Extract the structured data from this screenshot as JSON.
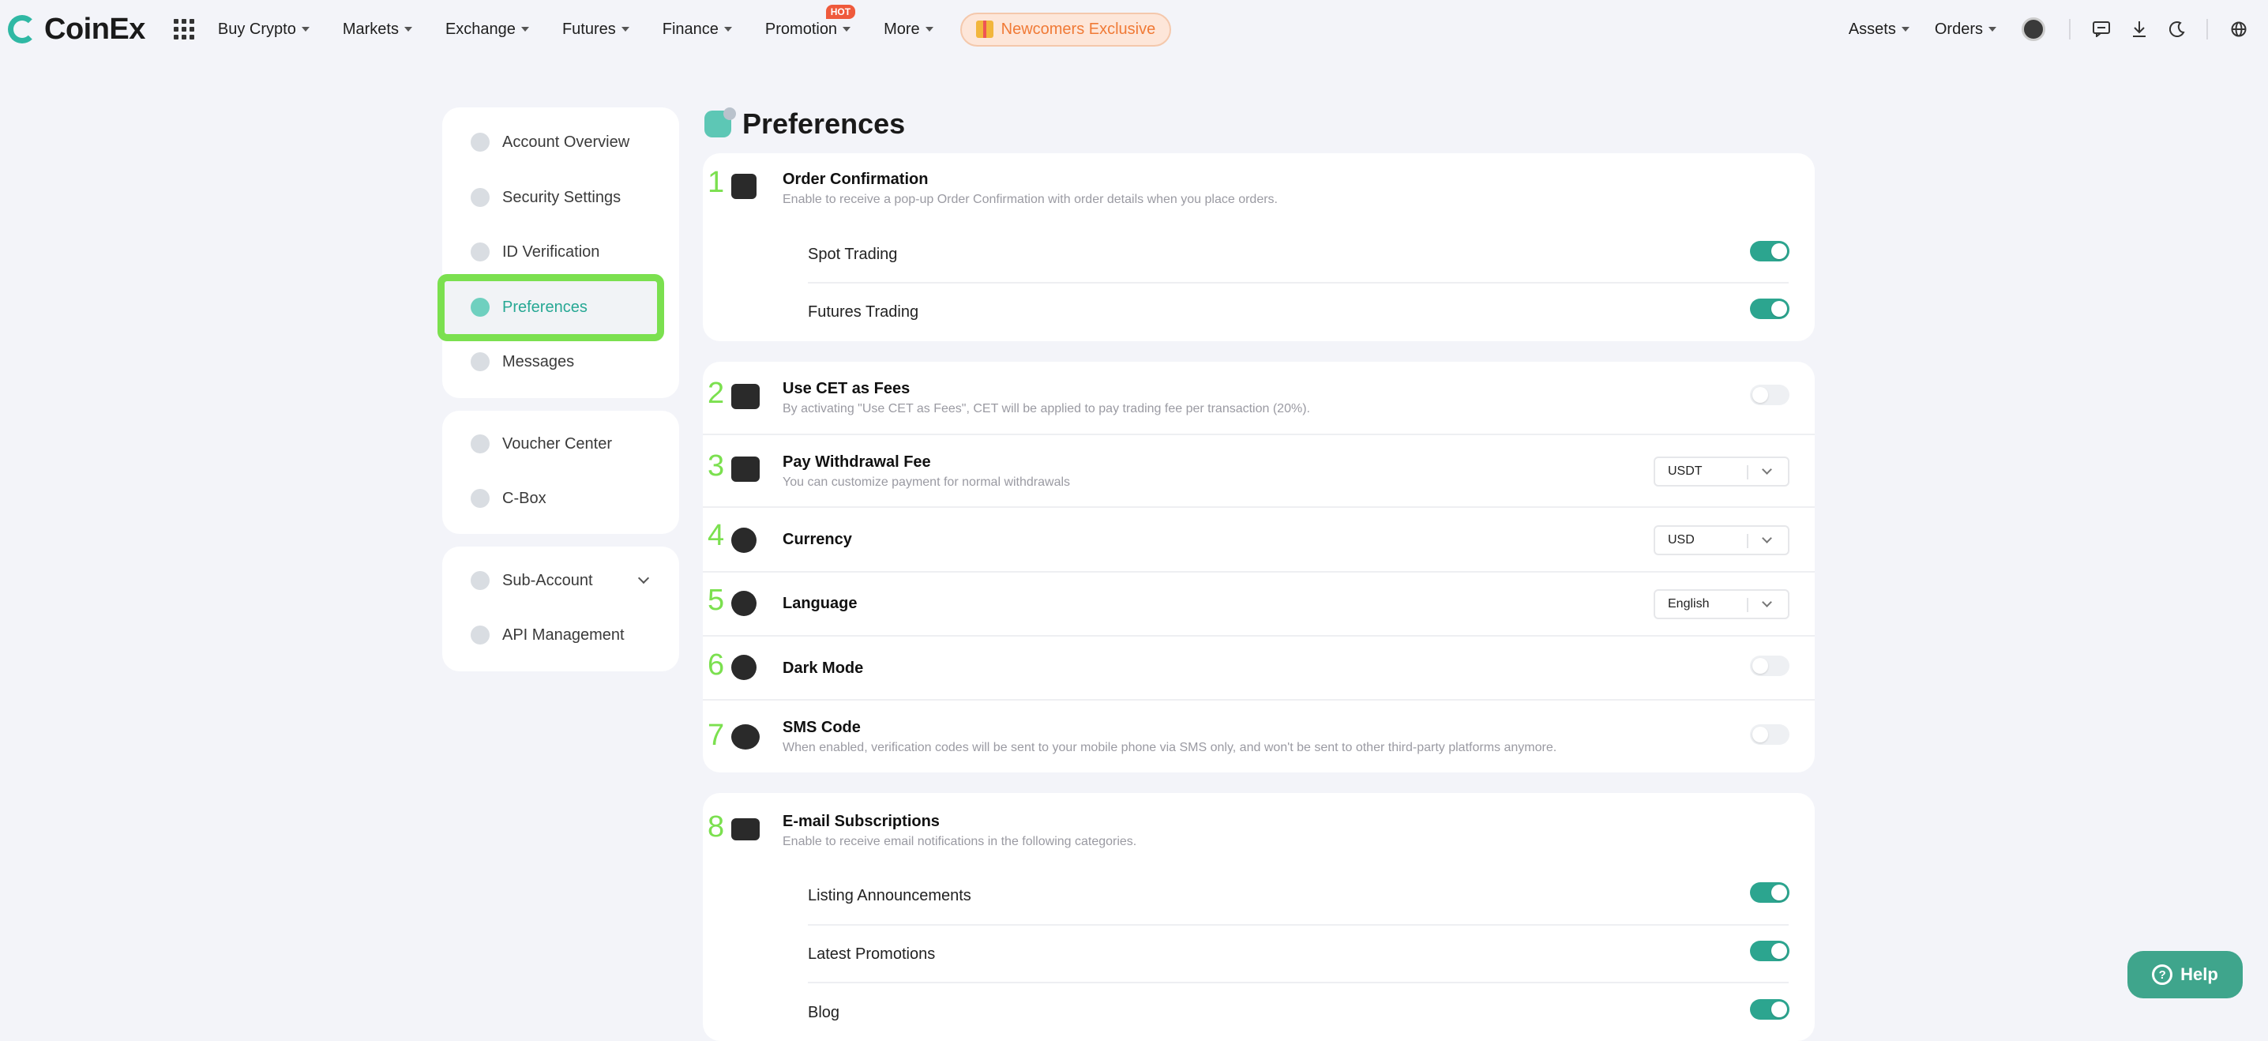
{
  "brand": {
    "name": "CoinEx",
    "accent": "#2ca58f",
    "highlight": "#7be04f"
  },
  "topnav": {
    "items": [
      {
        "label": "Buy Crypto"
      },
      {
        "label": "Markets"
      },
      {
        "label": "Exchange"
      },
      {
        "label": "Futures"
      },
      {
        "label": "Finance"
      },
      {
        "label": "Promotion",
        "badge": "HOT"
      },
      {
        "label": "More"
      }
    ],
    "newcomers_label": "Newcomers Exclusive",
    "right": {
      "assets": "Assets",
      "orders": "Orders"
    },
    "right_icons": [
      "avatar",
      "chat-icon",
      "download-icon",
      "moon-icon",
      "globe-icon"
    ]
  },
  "sidebar": {
    "group1": [
      {
        "label": "Account Overview",
        "icon": "pie-chart-icon"
      },
      {
        "label": "Security Settings",
        "icon": "shield-icon"
      },
      {
        "label": "ID Verification",
        "icon": "id-icon"
      },
      {
        "label": "Preferences",
        "icon": "preferences-icon",
        "active": true
      },
      {
        "label": "Messages",
        "icon": "message-icon"
      }
    ],
    "group2": [
      {
        "label": "Voucher Center",
        "icon": "voucher-icon"
      },
      {
        "label": "C-Box",
        "icon": "cbox-icon"
      }
    ],
    "group3": [
      {
        "label": "Sub-Account",
        "icon": "sub-account-icon"
      },
      {
        "label": "API Management",
        "icon": "api-icon"
      }
    ]
  },
  "main": {
    "title": "Preferences",
    "order_confirmation": {
      "num": "1",
      "title": "Order Confirmation",
      "desc": "Enable to receive a pop-up Order Confirmation with order details when you place orders.",
      "spot": {
        "label": "Spot Trading",
        "on": true
      },
      "futures": {
        "label": "Futures Trading",
        "on": true
      }
    },
    "cet_fees": {
      "num": "2",
      "title": "Use CET as Fees",
      "desc": "By activating \"Use CET as Fees\", CET will be applied to pay trading fee per transaction (20%).",
      "on": false
    },
    "withdrawal_fee": {
      "num": "3",
      "title": "Pay Withdrawal Fee",
      "desc": "You can customize payment for normal withdrawals",
      "value": "USDT"
    },
    "currency": {
      "num": "4",
      "title": "Currency",
      "value": "USD"
    },
    "language": {
      "num": "5",
      "title": "Language",
      "value": "English"
    },
    "dark_mode": {
      "num": "6",
      "title": "Dark Mode",
      "on": false
    },
    "sms_code": {
      "num": "7",
      "title": "SMS Code",
      "desc": "When enabled, verification codes will be sent to your mobile phone via SMS only, and won't be sent to other third-party platforms anymore.",
      "on": false
    },
    "email_subscriptions": {
      "num": "8",
      "title": "E-mail Subscriptions",
      "desc": "Enable to receive email notifications in the following categories.",
      "listing": {
        "label": "Listing Announcements",
        "on": true
      },
      "promotions": {
        "label": "Latest Promotions",
        "on": true
      },
      "blog": {
        "label": "Blog",
        "on": true
      }
    }
  },
  "help_label": "Help"
}
